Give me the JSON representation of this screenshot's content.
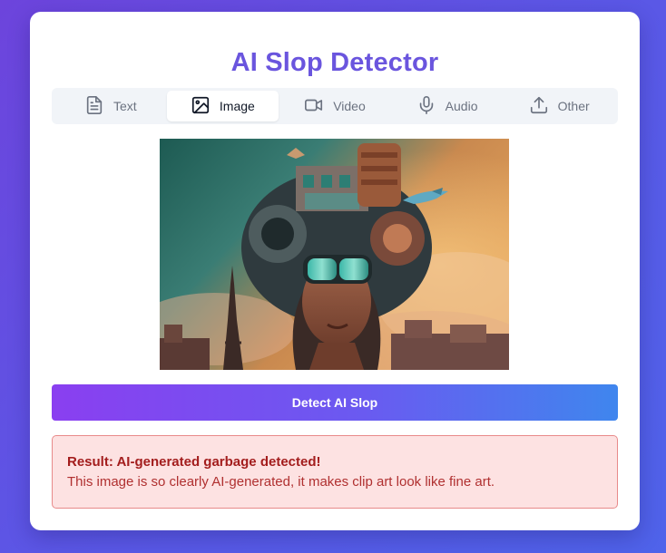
{
  "app": {
    "title": "AI Slop Detector"
  },
  "tabs": [
    {
      "label": "Text",
      "icon": "document-icon",
      "active": false
    },
    {
      "label": "Image",
      "icon": "image-icon",
      "active": true
    },
    {
      "label": "Video",
      "icon": "video-camera-icon",
      "active": false
    },
    {
      "label": "Audio",
      "icon": "microphone-icon",
      "active": false
    },
    {
      "label": "Other",
      "icon": "upload-icon",
      "active": false
    }
  ],
  "preview": {
    "description": "surreal collage of a woman wearing VR goggles with a city, buildings, birds and a fish on her head, Eiffel tower in background"
  },
  "detect_button": {
    "label": "Detect AI Slop"
  },
  "result": {
    "title": "Result: AI-generated garbage detected!",
    "text": "This image is so clearly AI-generated, it makes clip art look like fine art."
  },
  "colors": {
    "accent": "#6a55de",
    "background_start": "#6d44dc",
    "background_end": "#4f63ea",
    "button_start": "#8a3ff0",
    "button_end": "#3f86ee",
    "result_bg": "#fde2e2",
    "result_border": "#e88a8a",
    "result_text": "#a31d1d"
  }
}
